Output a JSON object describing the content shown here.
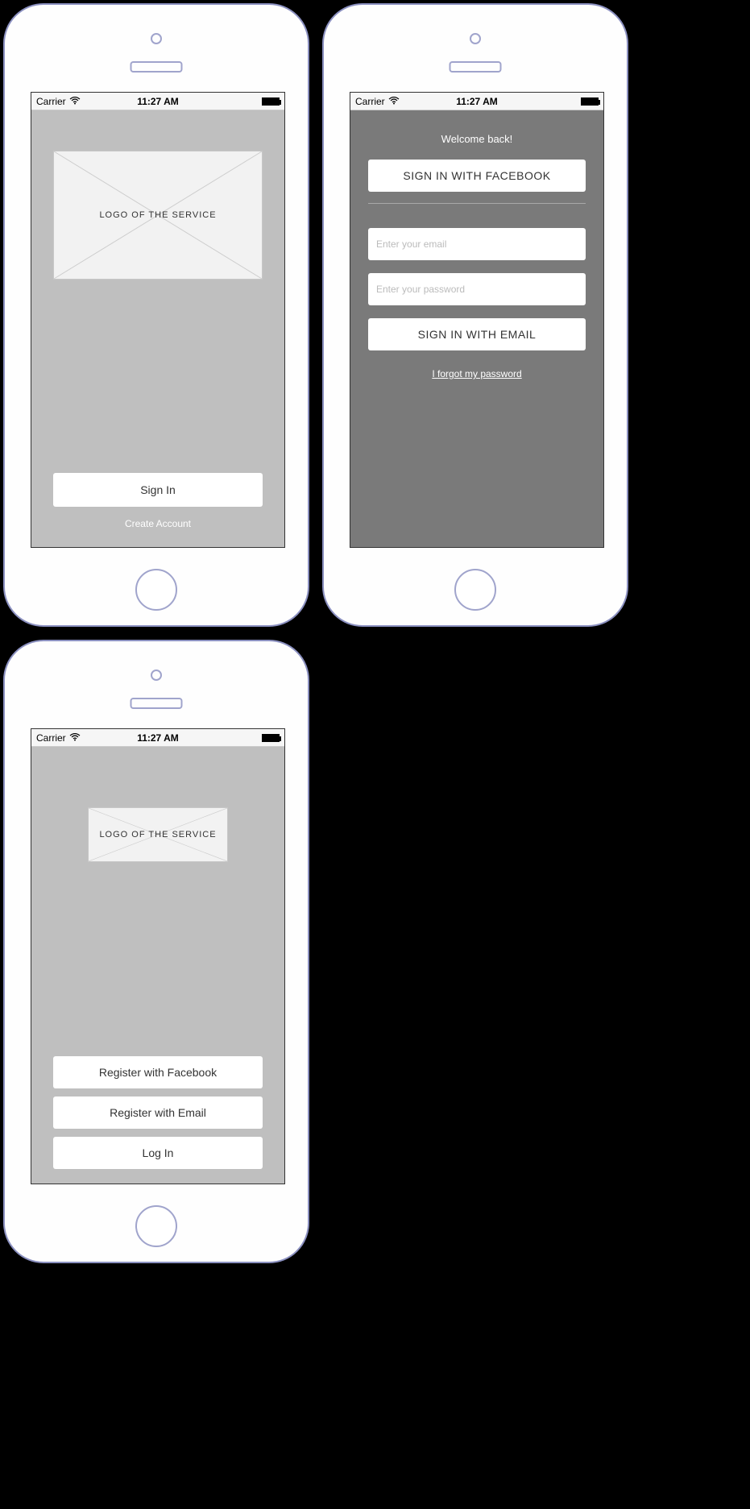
{
  "statusbar": {
    "carrier": "Carrier",
    "time": "11:27 AM"
  },
  "screen1": {
    "logo_text": "LOGO OF THE SERVICE",
    "signin": "Sign In",
    "create": "Create Account"
  },
  "screen2": {
    "welcome": "Welcome back!",
    "fb": "SIGN IN WITH FACEBOOK",
    "email_ph": "Enter your email",
    "pass_ph": "Enter your password",
    "email_btn": "SIGN IN WITH EMAIL",
    "forgot": "I forgot my password"
  },
  "screen3": {
    "logo_text": "LOGO OF THE SERVICE",
    "reg_fb": "Register with Facebook",
    "reg_email": "Register with Email",
    "login": "Log In"
  }
}
